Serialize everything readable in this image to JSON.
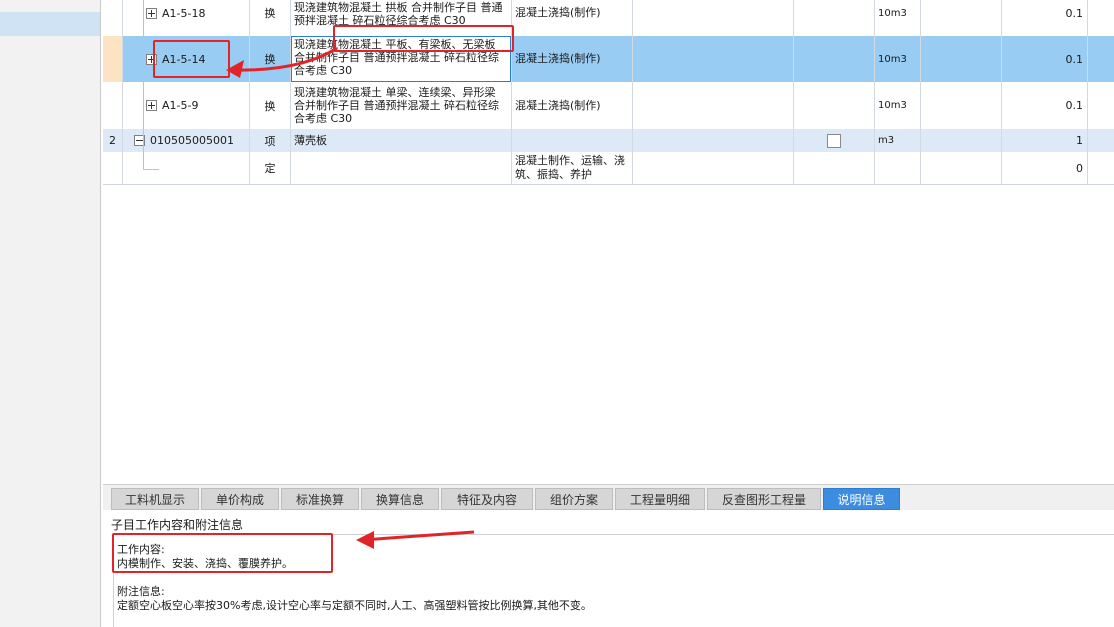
{
  "grid": {
    "rows": [
      {
        "num": "",
        "code": "A1-5-18",
        "type": "换",
        "name": "现浇建筑物混凝土 拱板 合并制作子目 普通预拌混凝土 碎石粒径综合考虑 C30",
        "feature": "混凝土浇捣(制作)",
        "unit": "10m3",
        "qty": "0.1"
      },
      {
        "num": "",
        "code": "A1-5-14",
        "type": "换",
        "name": "现浇建筑物混凝土 平板、有梁板、无梁板 合并制作子目 普通预拌混凝土 碎石粒径综合考虑 C30",
        "feature": "混凝土浇捣(制作)",
        "unit": "10m3",
        "qty": "0.1"
      },
      {
        "num": "",
        "code": "A1-5-9",
        "type": "换",
        "name": "现浇建筑物混凝土 单梁、连续梁、异形梁 合并制作子目 普通预拌混凝土 碎石粒径综合考虑 C30",
        "feature": "混凝土浇捣(制作)",
        "unit": "10m3",
        "qty": "0.1"
      },
      {
        "num": "2",
        "code": "010505005001",
        "type": "项",
        "name": "薄壳板",
        "feature": "",
        "unit": "m3",
        "qty": "1"
      },
      {
        "num": "",
        "code": "",
        "type": "定",
        "name": "",
        "feature": "混凝土制作、运输、浇筑、振捣、养护",
        "unit": "",
        "qty": "0"
      }
    ]
  },
  "tabs": [
    "工料机显示",
    "单价构成",
    "标准换算",
    "换算信息",
    "特征及内容",
    "组价方案",
    "工程量明细",
    "反查图形工程量",
    "说明信息"
  ],
  "active_tab": "说明信息",
  "info": {
    "title": "子目工作内容和附注信息",
    "work_label": "工作内容:",
    "work_text": "内模制作、安装、浇捣、覆膜养护。",
    "note_label": "附注信息:",
    "note_text": "定额空心板空心率按30%考虑,设计空心率与定额不同时,人工、高强塑料管按比例换算,其他不变。"
  },
  "colors": {
    "selected_row": "#99ccf2",
    "active_tab": "#3c8de0",
    "annotation": "#e0242a"
  }
}
